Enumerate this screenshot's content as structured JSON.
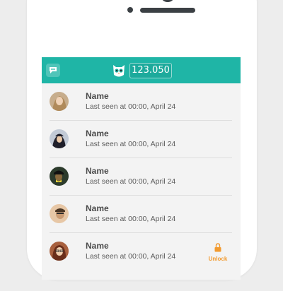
{
  "header": {
    "coins": "123.050",
    "accent_color": "#1fb5a6",
    "chat_icon": "chat-bubble-icon",
    "mascot_icon": "owl-mascot-icon"
  },
  "contacts": [
    {
      "name": "Name",
      "last_seen": "Last seen at 00:00, April 24",
      "locked": false
    },
    {
      "name": "Name",
      "last_seen": "Last seen at 00:00, April 24",
      "locked": false
    },
    {
      "name": "Name",
      "last_seen": "Last seen at 00:00, April 24",
      "locked": false
    },
    {
      "name": "Name",
      "last_seen": "Last seen at 00:00, April 24",
      "locked": false
    },
    {
      "name": "Name",
      "last_seen": "Last seen at 00:00, April 24",
      "locked": true
    }
  ],
  "unlock": {
    "label": "Unlock",
    "icon": "padlock-icon",
    "color": "#f29a2e"
  }
}
